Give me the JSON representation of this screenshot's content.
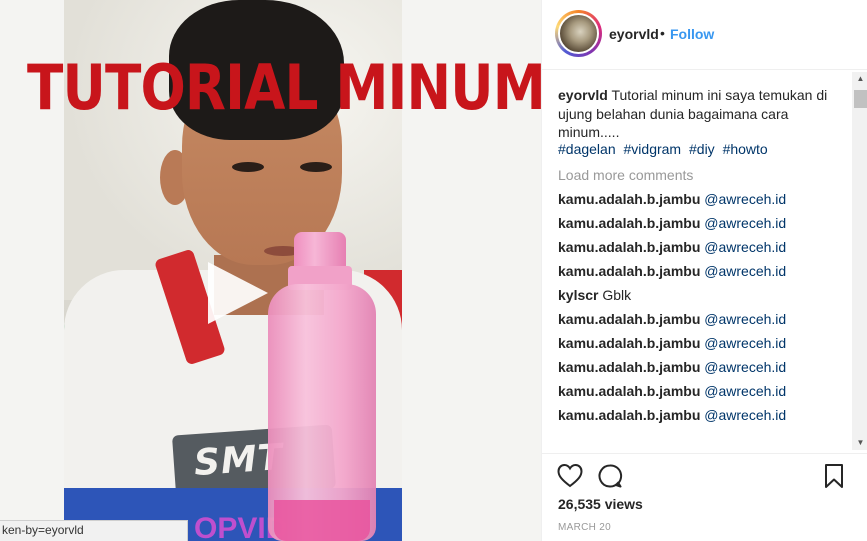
{
  "video": {
    "overlay_title": "TUTORIAL MINUM",
    "shirt_text": "SMT",
    "bottom_text": "OPVID"
  },
  "status_bar": {
    "url_fragment": "ken-by=eyorvld"
  },
  "header": {
    "username": "eyorvld",
    "separator": "•",
    "follow_label": "Follow"
  },
  "caption": {
    "username": "eyorvld",
    "text": "Tutorial minum ini saya temukan di ujung belahan dunia bagaimana cara minum.....",
    "hashtags": [
      "#dagelan",
      "#vidgram",
      "#diy",
      "#howto"
    ]
  },
  "load_more_label": "Load more comments",
  "comments": [
    {
      "user": "kamu.adalah.b.jambu",
      "mention": "@awreceh.id",
      "text": ""
    },
    {
      "user": "kamu.adalah.b.jambu",
      "mention": "@awreceh.id",
      "text": ""
    },
    {
      "user": "kamu.adalah.b.jambu",
      "mention": "@awreceh.id",
      "text": ""
    },
    {
      "user": "kamu.adalah.b.jambu",
      "mention": "@awreceh.id",
      "text": ""
    },
    {
      "user": "kylscr",
      "mention": "",
      "text": "Gblk"
    },
    {
      "user": "kamu.adalah.b.jambu",
      "mention": "@awreceh.id",
      "text": ""
    },
    {
      "user": "kamu.adalah.b.jambu",
      "mention": "@awreceh.id",
      "text": ""
    },
    {
      "user": "kamu.adalah.b.jambu",
      "mention": "@awreceh.id",
      "text": ""
    },
    {
      "user": "kamu.adalah.b.jambu",
      "mention": "@awreceh.id",
      "text": ""
    },
    {
      "user": "kamu.adalah.b.jambu",
      "mention": "@awreceh.id",
      "text": ""
    }
  ],
  "stats": {
    "views": "26,535 views",
    "date": "MARCH 20"
  },
  "colors": {
    "link": "#3897f0",
    "hashtag": "#003569",
    "overlay_title": "#c8151b"
  },
  "icons": {
    "like": "heart-icon",
    "comment": "comment-bubble-icon",
    "save": "bookmark-icon",
    "play": "play-icon"
  }
}
